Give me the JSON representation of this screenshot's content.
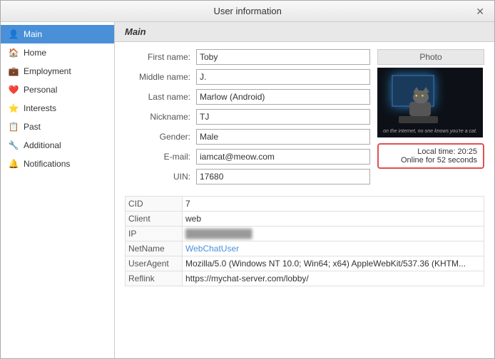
{
  "window": {
    "title": "User information",
    "close_label": "✕"
  },
  "sidebar": {
    "items": [
      {
        "id": "main",
        "label": "Main",
        "icon": "👤",
        "active": true
      },
      {
        "id": "home",
        "label": "Home",
        "icon": "🏠",
        "active": false
      },
      {
        "id": "employment",
        "label": "Employment",
        "icon": "💼",
        "active": false
      },
      {
        "id": "personal",
        "label": "Personal",
        "icon": "❤️",
        "active": false
      },
      {
        "id": "interests",
        "label": "Interests",
        "icon": "⭐",
        "active": false
      },
      {
        "id": "past",
        "label": "Past",
        "icon": "📋",
        "active": false
      },
      {
        "id": "additional",
        "label": "Additional",
        "icon": "🔧",
        "active": false
      },
      {
        "id": "notifications",
        "label": "Notifications",
        "icon": "🔔",
        "active": false
      }
    ]
  },
  "panel": {
    "title": "Main",
    "photo_label": "Photo",
    "status": {
      "line1": "Local time: 20:25",
      "line2": "Online for 52 seconds"
    }
  },
  "form": {
    "fields": [
      {
        "label": "First name:",
        "value": "Toby"
      },
      {
        "label": "Middle name:",
        "value": "J."
      },
      {
        "label": "Last name:",
        "value": "Marlow (Android)"
      },
      {
        "label": "Nickname:",
        "value": "TJ"
      },
      {
        "label": "Gender:",
        "value": "Male"
      },
      {
        "label": "E-mail:",
        "value": "iamcat@meow.com"
      },
      {
        "label": "UIN:",
        "value": "17680"
      }
    ]
  },
  "info_table": {
    "rows": [
      {
        "key": "CID",
        "value": "7"
      },
      {
        "key": "Client",
        "value": "web"
      },
      {
        "key": "IP",
        "value": "███████████"
      },
      {
        "key": "NetName",
        "value": "WebChatUser"
      },
      {
        "key": "UserAgent",
        "value": "Mozilla/5.0 (Windows NT 10.0; Win64; x64) AppleWebKit/537.36 (KHTM..."
      },
      {
        "key": "Reflink",
        "value": "https://mychat-server.com/lobby/"
      }
    ]
  }
}
